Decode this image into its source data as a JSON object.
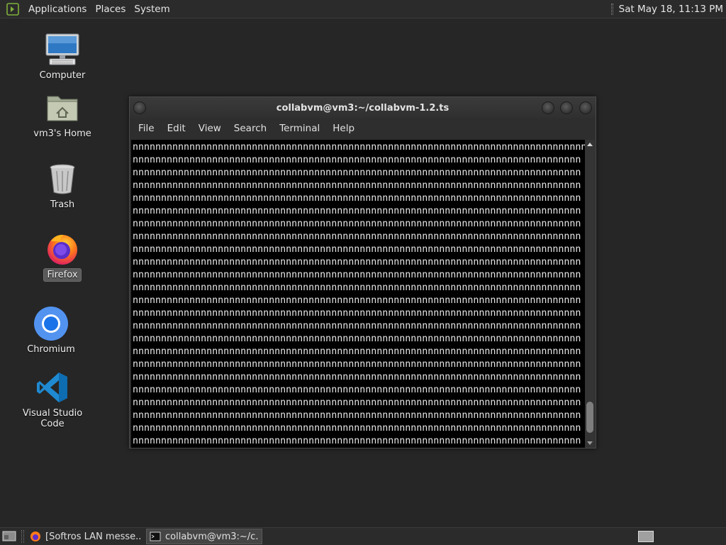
{
  "top_panel": {
    "menus": [
      "Applications",
      "Places",
      "System"
    ],
    "clock": "Sat May 18, 11:13 PM"
  },
  "desktop_icons": [
    {
      "label": "Computer",
      "icon": "computer-icon"
    },
    {
      "label": "vm3's Home",
      "icon": "home-folder-icon"
    },
    {
      "label": "Trash",
      "icon": "trash-icon"
    },
    {
      "label": "Firefox",
      "icon": "firefox-icon",
      "selected": true
    },
    {
      "label": "Chromium",
      "icon": "chromium-icon"
    },
    {
      "label": "Visual Studio Code",
      "icon": "vscode-icon"
    }
  ],
  "terminal": {
    "title": "collabvm@vm3:~/collabvm-1.2.ts",
    "menu": [
      "File",
      "Edit",
      "View",
      "Search",
      "Terminal",
      "Help"
    ],
    "content": "nnnnnnnnnnnnnnnnnnnnnnnnnnnnnnnnnnnnnnnnnnnnnnnnnnnnnnnnnnnnnnnnnnnnnnnnnnnnnnnn\nnnnnnnnnnnnnnnnnnnnnnnnnnnnnnnnnnnnnnnnnnnnnnnnnnnnnnnnnnnnnnnnnnnnnnnnnnnnnnnn\nnnnnnnnnnnnnnnnnnnnnnnnnnnnnnnnnnnnnnnnnnnnnnnnnnnnnnnnnnnnnnnnnnnnnnnnnnnnnnnn\nnnnnnnnnnnnnnnnnnnnnnnnnnnnnnnnnnnnnnnnnnnnnnnnnnnnnnnnnnnnnnnnnnnnnnnnnnnnnnnn\nnnnnnnnnnnnnnnnnnnnnnnnnnnnnnnnnnnnnnnnnnnnnnnnnnnnnnnnnnnnnnnnnnnnnnnnnnnnnnnn\nnnnnnnnnnnnnnnnnnnnnnnnnnnnnnnnnnnnnnnnnnnnnnnnnnnnnnnnnnnnnnnnnnnnnnnnnnnnnnnn\nnnnnnnnnnnnnnnnnnnnnnnnnnnnnnnnnnnnnnnnnnnnnnnnnnnnnnnnnnnnnnnnnnnnnnnnnnnnnnnn\nnnnnnnnnnnnnnnnnnnnnnnnnnnnnnnnnnnnnnnnnnnnnnnnnnnnnnnnnnnnnnnnnnnnnnnnnnnnnnnn\nnnnnnnnnnnnnnnnnnnnnnnnnnnnnnnnnnnnnnnnnnnnnnnnnnnnnnnnnnnnnnnnnnnnnnnnnnnnnnnn\nnnnnnnnnnnnnnnnnnnnnnnnnnnnnnnnnnnnnnnnnnnnnnnnnnnnnnnnnnnnnnnnnnnnnnnnnnnnnnnn\nnnnnnnnnnnnnnnnnnnnnnnnnnnnnnnnnnnnnnnnnnnnnnnnnnnnnnnnnnnnnnnnnnnnnnnnnnnnnnnn\nnnnnnnnnnnnnnnnnnnnnnnnnnnnnnnnnnnnnnnnnnnnnnnnnnnnnnnnnnnnnnnnnnnnnnnnnnnnnnnn\nnnnnnnnnnnnnnnnnnnnnnnnnnnnnnnnnnnnnnnnnnnnnnnnnnnnnnnnnnnnnnnnnnnnnnnnnnnnnnnn\nnnnnnnnnnnnnnnnnnnnnnnnnnnnnnnnnnnnnnnnnnnnnnnnnnnnnnnnnnnnnnnnnnnnnnnnnnnnnnnn\nnnnnnnnnnnnnnnnnnnnnnnnnnnnnnnnnnnnnnnnnnnnnnnnnnnnnnnnnnnnnnnnnnnnnnnnnnnnnnnn\nnnnnnnnnnnnnnnnnnnnnnnnnnnnnnnnnnnnnnnnnnnnnnnnnnnnnnnnnnnnnnnnnnnnnnnnnnnnnnnn\nnnnnnnnnnnnnnnnnnnnnnnnnnnnnnnnnnnnnnnnnnnnnnnnnnnnnnnnnnnnnnnnnnnnnnnnnnnnnnnn\nnnnnnnnnnnnnnnnnnnnnnnnnnnnnnnnnnnnnnnnnnnnnnnnnnnnnnnnnnnnnnnnnnnnnnnnnnnnnnnn\nnnnnnnnnnnnnnnnnnnnnnnnnnnnnnnnnnnnnnnnnnnnnnnnnnnnnnnnnnnnnnnnnnnnnnnnnnnnnnnn\nnnnnnnnnnnnnnnnnnnnnnnnnnnnnnnnnnnnnnnnnnnnnnnnnnnnnnnnnnnnnnnnnnnnnnnnnnnnnnnn\nnnnnnnnnnnnnnnnnnnnnnnnnnnnnnnnnnnnnnnnnnnnnnnnnnnnnnnnnnnnnnnnnnnnnnnnnnnnnnnn\nnnnnnnnnnnnnnnnnnnnnnnnnnnnnnnnnnnnnnnnnnnnnnnnnnnnnnnnnnnnnnnnnnnnnnnnnnnnnnnn\nnnnnnnnnnnnnnnnnnnnnnnnnnnnnnnnnnnnnnnnnnnnnnnnnnnnnnnnnnnnnnnnnnnnnnnnnnnnnnnn\nnnnnnnnnnnnnnnnnnnnnnnnnnnnnnnnnnnnnnnnnnnnnnnnnnnnnnnnnnnnnnnnnnnnnnnnnnnnnnnn\nnnnnnnnnnnnnnnnnnnnnnnnnnnnnnnnnnnnnnnnnnnnnnnnnnnnnnnnnnnnnnn",
    "scroll_position": 0.98
  },
  "taskbar": {
    "tasks": [
      {
        "label": "[Softros LAN messe...",
        "icon": "firefox-icon",
        "active": false
      },
      {
        "label": "collabvm@vm3:~/c...",
        "icon": "terminal-icon",
        "active": true
      }
    ]
  },
  "colors": {
    "desktop_bg": "#262626",
    "panel_bg": "#2b2b2b",
    "terminal_bg": "#000000",
    "terminal_fg": "#e8e8e8"
  }
}
